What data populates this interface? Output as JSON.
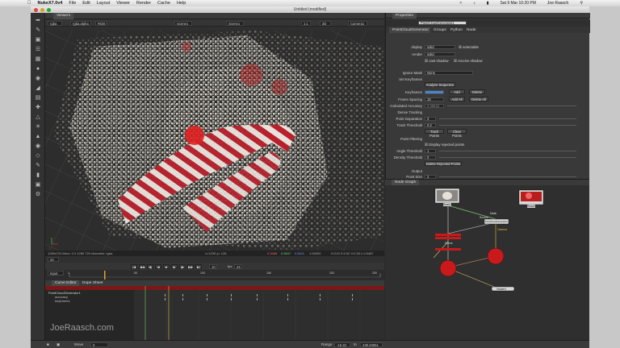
{
  "menubar": {
    "app_name": "NukeX7.0v4",
    "items": [
      "File",
      "Edit",
      "Layout",
      "Viewer",
      "Render",
      "Cache",
      "Help"
    ],
    "status_date": "Sat 9 Mar 10:20 PM",
    "user": "Joe Raasch"
  },
  "window": {
    "title": "Untitled (modified)"
  },
  "viewer": {
    "tab_label": "Viewer1",
    "channels": "rgba",
    "channel_alpha": "rgba.alpha",
    "colorspace": "RGB",
    "input_a": "Scene1",
    "input_b": "Scene1",
    "mode": "3D",
    "camera": "Camera1",
    "zoom": "1:1",
    "info_line": "1280x720 bbox: 0 0 1280 720 channels: rgba",
    "coords": "x=1230 y= 126",
    "pixel_r": "0.3468",
    "pixel_g": "0.5647",
    "pixel_b": "0.5411",
    "pixel_a": "1.00000",
    "hsv": "H:215 S:0.52 V:0.35 L:0.5487",
    "frame": "22",
    "fps": "24",
    "timeline_ticks": [
      "1",
      "50",
      "100",
      "150",
      "200",
      "250"
    ],
    "input_label": "Input"
  },
  "curve_editor": {
    "tabs": [
      "Curve Editor",
      "Dope Sheet"
    ],
    "tree": [
      "PointCloudGenerator1",
      "accuracy",
      "keyframes"
    ],
    "watermark": "JoeRaasch.com"
  },
  "bottombar": {
    "move_label": "Move",
    "range_label": "Range",
    "range_start": "-16.33",
    "range_end": "239.33051"
  },
  "properties": {
    "panel_title": "Properties",
    "node_name": "PointCloudGenerator1",
    "tabs": [
      "PointCloudGenerator",
      "Groups",
      "Python",
      "Node"
    ],
    "display": {
      "label": "display",
      "value": "solid",
      "selectable": "selectable"
    },
    "render": {
      "label": "render",
      "value": "solid"
    },
    "shadow_opts": [
      "cast shadow",
      "receive shadow"
    ],
    "ignore_mask": {
      "label": "Ignore Mask",
      "value": "None"
    },
    "set_keyframes": "Set Keyframes",
    "analyze_sequence": "Analyze Sequence",
    "keyframes": {
      "label": "Keyframes",
      "add": "Add",
      "delete": "Delete"
    },
    "frame_spacing": {
      "label": "Frame Spacing",
      "value": "15",
      "add_all": "Add All",
      "delete_all": "Delete All"
    },
    "calc_accuracy": {
      "label": "Calculated Accuracy",
      "value": "0.39633"
    },
    "dense_tracking": "Dense Tracking",
    "point_separation": {
      "label": "Point Separation",
      "value": "3"
    },
    "track_threshold": {
      "label": "Track Threshold",
      "value": "0.2"
    },
    "track_points": "Track Points",
    "clear_points": "Clear Points",
    "point_filtering": "Point Filtering",
    "display_rejected": "Display rejected points",
    "angle_threshold": {
      "label": "Angle Threshold",
      "value": "1"
    },
    "density_threshold": {
      "label": "Density Threshold",
      "value": "0"
    },
    "delete_rejected": "Delete Rejected Points",
    "output": "Output",
    "point_size": {
      "label": "Point Size",
      "value": "2"
    }
  },
  "nodegraph": {
    "tab_label": "Node Graph",
    "nodes": {
      "read1": "Read1",
      "read2": "Read2",
      "pointcloud": "PointCloudGenerator1",
      "camera": "Camera",
      "scene": "Scene",
      "viewer": "Viewer1",
      "mask_label": "Mask",
      "source_label": "Source"
    }
  },
  "colors": {
    "accent_red": "#c81a1a",
    "node_green": "#6dc04a",
    "node_yellow": "#e0c23a",
    "highlight_blue": "#4a86c8"
  }
}
